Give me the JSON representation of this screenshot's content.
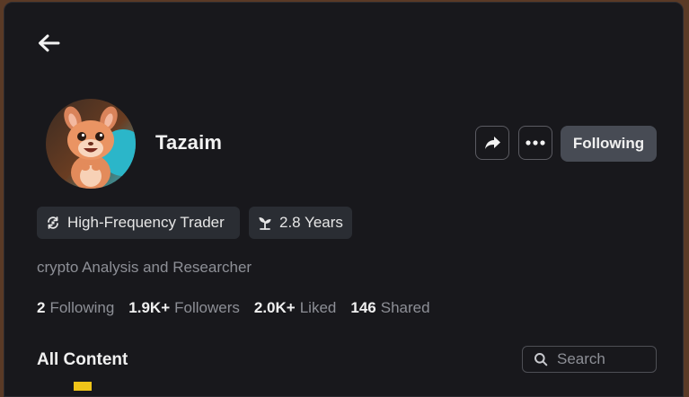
{
  "header": {
    "back_icon": "arrow-left-icon"
  },
  "profile": {
    "avatar_icon": "squirrel-avatar",
    "username": "Tazaim",
    "share_icon": "share-icon",
    "more_icon": "more-dots-icon",
    "follow_label": "Following",
    "tags": [
      {
        "icon": "sync-icon",
        "label": "High-Frequency Trader"
      },
      {
        "icon": "sprout-icon",
        "label": "2.8 Years"
      }
    ],
    "bio": "crypto Analysis and Researcher",
    "stats": [
      {
        "value": "2",
        "label": "Following"
      },
      {
        "value": "1.9K+",
        "label": "Followers"
      },
      {
        "value": "2.0K+",
        "label": "Liked"
      },
      {
        "value": "146",
        "label": "Shared"
      }
    ]
  },
  "content": {
    "title": "All Content",
    "search_placeholder": "Search"
  },
  "colors": {
    "background": "#18181c",
    "button_bg": "#474b54",
    "tag_bg": "#2a2d33",
    "muted_text": "#8d8f96",
    "accent_yellow": "#f0c419"
  }
}
